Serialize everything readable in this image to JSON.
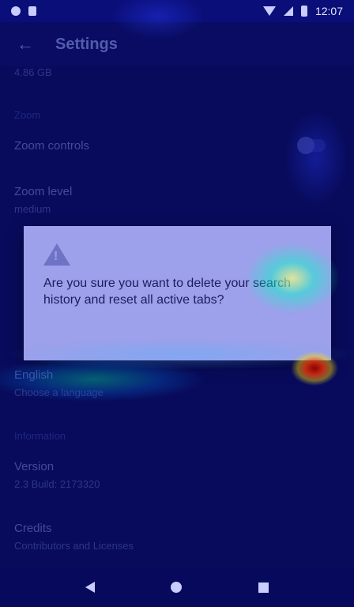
{
  "status_bar": {
    "time": "12:07"
  },
  "toolbar": {
    "title": "Settings"
  },
  "settings": {
    "storage_value": "4.86 GB",
    "zoom_section": "Zoom",
    "zoom_controls": "Zoom controls",
    "zoom_level_title": "Zoom level",
    "zoom_level_value": "medium",
    "language_title": "English",
    "language_sub": "Choose a language",
    "info_section": "Information",
    "version_title": "Version",
    "version_value": "2.3 Build: 2173320",
    "credits_title": "Credits",
    "credits_sub": "Contributors and Licenses"
  },
  "dialog": {
    "message": "Are you sure you want to delete your search history and reset all active tabs?",
    "icon": "warning-icon"
  },
  "colors": {
    "dialog_bg": "#9da0ea",
    "background": "#0b0f6e"
  }
}
